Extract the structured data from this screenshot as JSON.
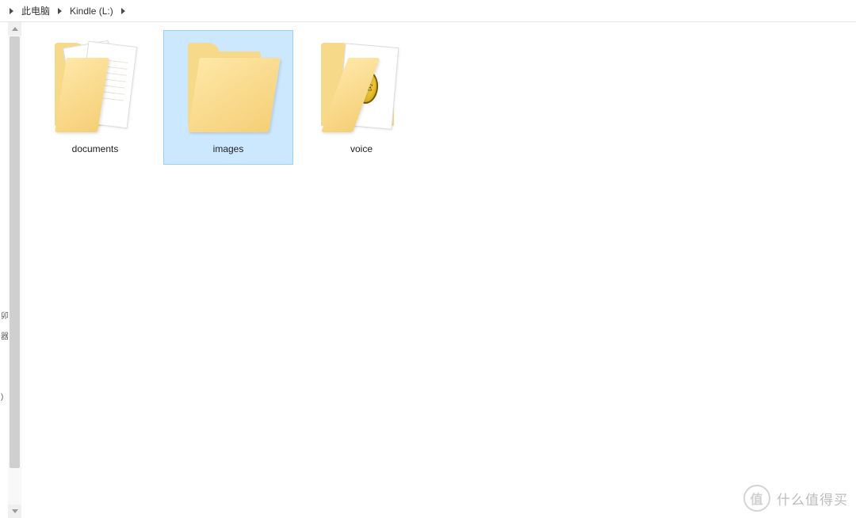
{
  "breadcrumb": {
    "seg1": "此电脑",
    "seg2": "Kindle (L:)"
  },
  "items": [
    {
      "name": "documents",
      "kind": "folder-with-docs",
      "selected": false
    },
    {
      "name": "images",
      "kind": "folder-empty",
      "selected": true
    },
    {
      "name": "voice",
      "kind": "folder-ue",
      "selected": false
    }
  ],
  "watermark": {
    "text": "什么值得买",
    "coin": "值"
  }
}
